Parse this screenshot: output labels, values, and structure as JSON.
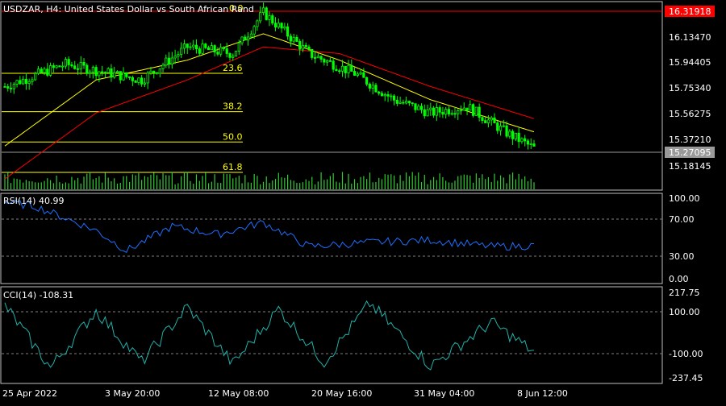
{
  "title": "USDZAR, H4:  United States Dollar vs South African Rand",
  "colors": {
    "background": "#000000",
    "frame": "#c0c0c0",
    "grid": "#808080",
    "candle": "#00ff00",
    "candle_body": "#7cfc00",
    "ma_fast": "#ffff00",
    "ma_slow": "#ff0000",
    "fib": "#ffff00",
    "volume": "#32cd32",
    "rsi": "#1e6fff",
    "cci": "#20b2aa",
    "bid": "#bfbfbf",
    "high_label_bg": "#ff0000"
  },
  "price_panel": {
    "price_axis_labels": [
      "16.13470",
      "15.94405",
      "15.75340",
      "15.56275",
      "15.37210",
      "15.18145"
    ],
    "high_label": "16.31918",
    "current_label": "15.27095",
    "fib_levels": [
      {
        "label": "0.0",
        "price": 16.31918
      },
      {
        "label": "23.6",
        "price": 15.85
      },
      {
        "label": "38.2",
        "price": 15.56
      },
      {
        "label": "50.0",
        "price": 15.33
      },
      {
        "label": "61.8",
        "price": 15.1
      }
    ]
  },
  "rsi_panel": {
    "label": "RSI(14) 40.99",
    "axis_labels": [
      "100.00",
      "70.00",
      "30.00",
      "0.00"
    ],
    "levels": [
      100,
      70,
      30,
      0
    ]
  },
  "cci_panel": {
    "label": "CCI(14) -108.31",
    "axis_labels": [
      "217.75",
      "100.00",
      "-100.00",
      "-237.45"
    ],
    "levels": [
      217.75,
      100,
      -100,
      -237.45
    ]
  },
  "time_axis": [
    "25 Apr 2022",
    "3 May 20:00",
    "12 May 08:00",
    "20 May 16:00",
    "31 May 04:00",
    "8 Jun 12:00"
  ],
  "chart_data": {
    "type": "candlestick",
    "symbol": "USDZAR",
    "timeframe": "H4",
    "title": "USDZAR, H4:  United States Dollar vs South African Rand",
    "ylim": [
      15.1,
      16.32
    ],
    "close_anchor_x": [
      0,
      20,
      45,
      60,
      75,
      85,
      100,
      115,
      128,
      140,
      152,
      165,
      175
    ],
    "close_anchor_y": [
      15.75,
      15.92,
      15.8,
      16.05,
      16.0,
      16.31,
      16.0,
      15.85,
      15.65,
      15.55,
      15.6,
      15.4,
      15.27
    ],
    "candles": 175,
    "ma_fast_anchor_x": [
      0,
      30,
      60,
      85,
      110,
      140,
      175
    ],
    "ma_fast_anchor_y": [
      15.3,
      15.8,
      15.95,
      16.15,
      15.95,
      15.65,
      15.4
    ],
    "ma_slow_anchor_x": [
      0,
      30,
      60,
      85,
      110,
      140,
      175
    ],
    "ma_slow_anchor_y": [
      15.05,
      15.55,
      15.8,
      16.05,
      16.0,
      15.75,
      15.5
    ],
    "rsi_last": 40.99,
    "rsi_anchor_x": [
      0,
      10,
      30,
      40,
      55,
      70,
      85,
      100,
      120,
      140,
      160,
      175
    ],
    "rsi_anchor_y": [
      95,
      90,
      60,
      35,
      65,
      55,
      70,
      40,
      45,
      48,
      40,
      41
    ],
    "cci_last": -108.31,
    "cci_anchor_x": [
      0,
      15,
      30,
      45,
      60,
      75,
      90,
      105,
      120,
      140,
      160,
      175
    ],
    "cci_anchor_y": [
      150,
      -180,
      120,
      -150,
      140,
      -160,
      130,
      -150,
      160,
      -170,
      60,
      -108.31
    ]
  }
}
